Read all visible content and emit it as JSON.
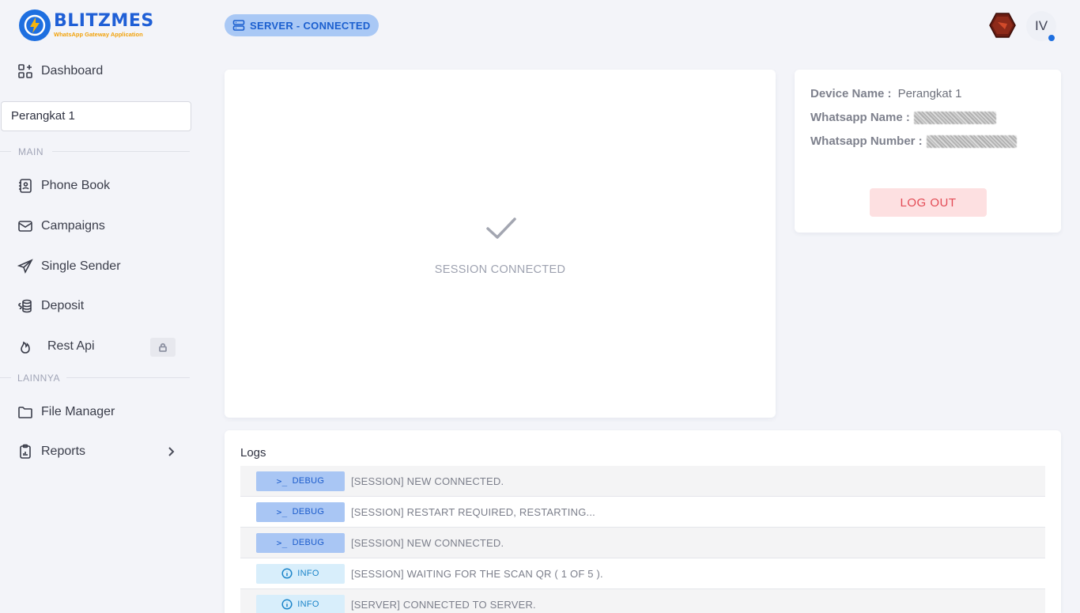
{
  "brand": {
    "name": "BLITZMES",
    "tagline": "WhatsApp Gateway Application"
  },
  "header": {
    "server_status": "SERVER - CONNECTED",
    "user_initials": "IV"
  },
  "sidebar": {
    "dashboard": "Dashboard",
    "device_select": "Perangkat 1",
    "section_main": "MAIN",
    "phone_book": "Phone Book",
    "campaigns": "Campaigns",
    "single_sender": "Single Sender",
    "deposit": "Deposit",
    "rest_api": "Rest Api",
    "section_other": "LAINNYA",
    "file_manager": "File Manager",
    "reports": "Reports"
  },
  "session": {
    "status": "SESSION CONNECTED"
  },
  "device_info": {
    "device_name_label": "Device Name :",
    "device_name": "Perangkat 1",
    "wa_name_label": "Whatsapp Name :",
    "wa_number_label": "Whatsapp Number :",
    "logout": "LOG OUT"
  },
  "logs": {
    "title": "Logs",
    "rows": [
      {
        "level": "DEBUG",
        "message": "[SESSION] NEW CONNECTED."
      },
      {
        "level": "DEBUG",
        "message": "[SESSION] RESTART REQUIRED, RESTARTING..."
      },
      {
        "level": "DEBUG",
        "message": "[SESSION] NEW CONNECTED."
      },
      {
        "level": "INFO",
        "message": "[SESSION] WAITING FOR THE SCAN QR ( 1 OF 5 )."
      },
      {
        "level": "INFO",
        "message": "[SERVER] CONNECTED TO SERVER."
      }
    ]
  },
  "colors": {
    "accent": "#1e6fe0",
    "danger": "#e34b55",
    "debug_bg": "#a9c6f4",
    "info_bg": "#d8eefb"
  }
}
